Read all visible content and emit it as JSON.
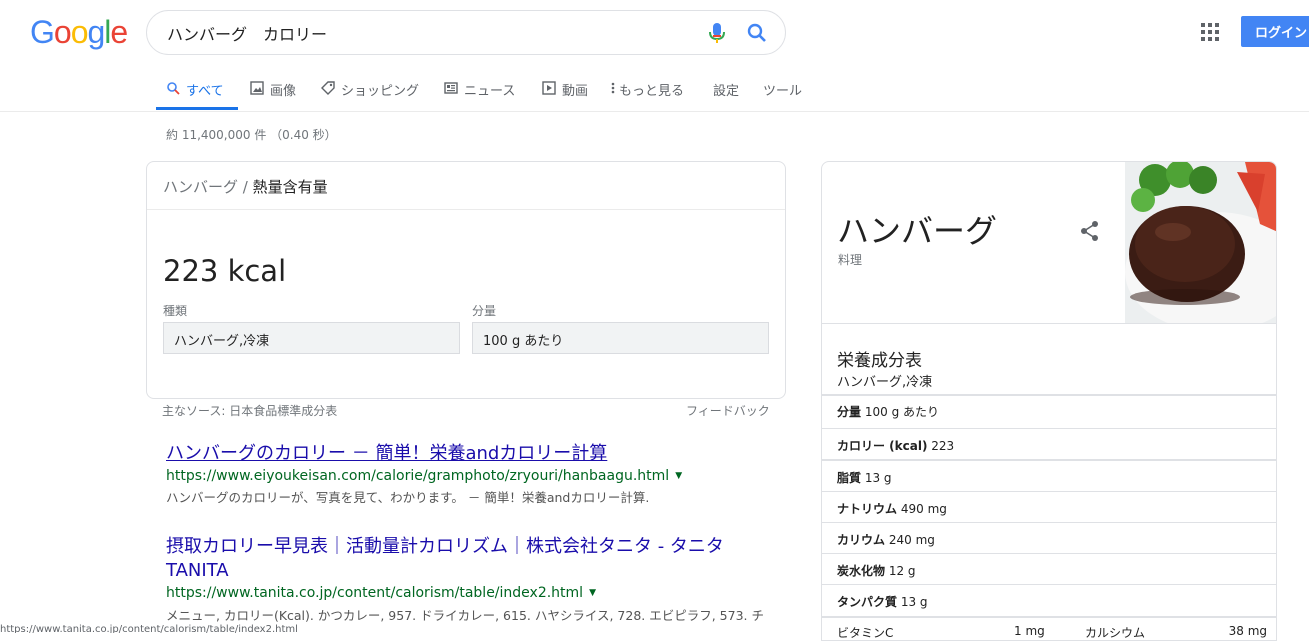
{
  "header": {
    "logo": "Google",
    "query": "ハンバーグ　カロリー",
    "login_label": "ログイン"
  },
  "tabs": [
    {
      "label": "すべて",
      "icon": "search-icon"
    },
    {
      "label": "画像",
      "icon": "image-icon"
    },
    {
      "label": "ショッピング",
      "icon": "tag-icon"
    },
    {
      "label": "ニュース",
      "icon": "news-icon"
    },
    {
      "label": "動画",
      "icon": "video-icon"
    },
    {
      "label": "もっと見る",
      "icon": "more-vert-icon"
    },
    {
      "label": "設定"
    },
    {
      "label": "ツール"
    }
  ],
  "stats": "約 11,400,000 件 （0.40 秒）",
  "snippet": {
    "breadcrumb_main": "ハンバーグ",
    "breadcrumb_sep": " / ",
    "breadcrumb_sub": "熱量含有量",
    "value": "223 kcal",
    "type_label": "種類",
    "type_value": "ハンバーグ,冷凍",
    "amount_label": "分量",
    "amount_value": "100 g あたり",
    "source": "主なソース: 日本食品標準成分表",
    "feedback": "フィードバック"
  },
  "results": [
    {
      "title": "ハンバーグのカロリー － 簡単！栄養andカロリー計算",
      "url": "https://www.eiyoukeisan.com/calorie/gramphoto/zryouri/hanbaagu.html",
      "snippet": "ハンバーグのカロリーが、写真を見て、わかります。 － 簡単！栄養andカロリー計算."
    },
    {
      "title": "摂取カロリー早見表｜活動量計カロリズム｜株式会社タニタ - タニタ",
      "title2": "TANITA",
      "url": "https://www.tanita.co.jp/content/calorism/table/index2.html",
      "snippet": "メニュー, カロリー(Kcal). かつカレー, 957. ドライカレー, 615. ハヤシライス, 728. エビピラフ, 573. チ"
    }
  ],
  "status_url": "https://www.tanita.co.jp/content/calorism/table/index2.html",
  "knowledge": {
    "title": "ハンバーグ",
    "subtitle": "料理",
    "nutrition_title": "栄養成分表",
    "nutrition_subtitle": "ハンバーグ,冷凍",
    "rows": [
      {
        "label": "分量",
        "value": "100 g あたり"
      },
      {
        "label": "カロリー (kcal)",
        "value": "223"
      },
      {
        "label": "脂質",
        "value": "13 g"
      },
      {
        "label": "ナトリウム",
        "value": "490 mg"
      },
      {
        "label": "カリウム",
        "value": "240 mg"
      },
      {
        "label": "炭水化物",
        "value": "12 g"
      },
      {
        "label": "タンパク質",
        "value": "13 g"
      }
    ],
    "vitamin_row": {
      "label": "ビタミンC",
      "value": "1 mg",
      "label2": "カルシウム",
      "value2": "38 mg"
    }
  },
  "colors": {
    "accent": "#1a73e8",
    "link": "#1a0dab",
    "url": "#006621",
    "login": "#4285f4"
  }
}
